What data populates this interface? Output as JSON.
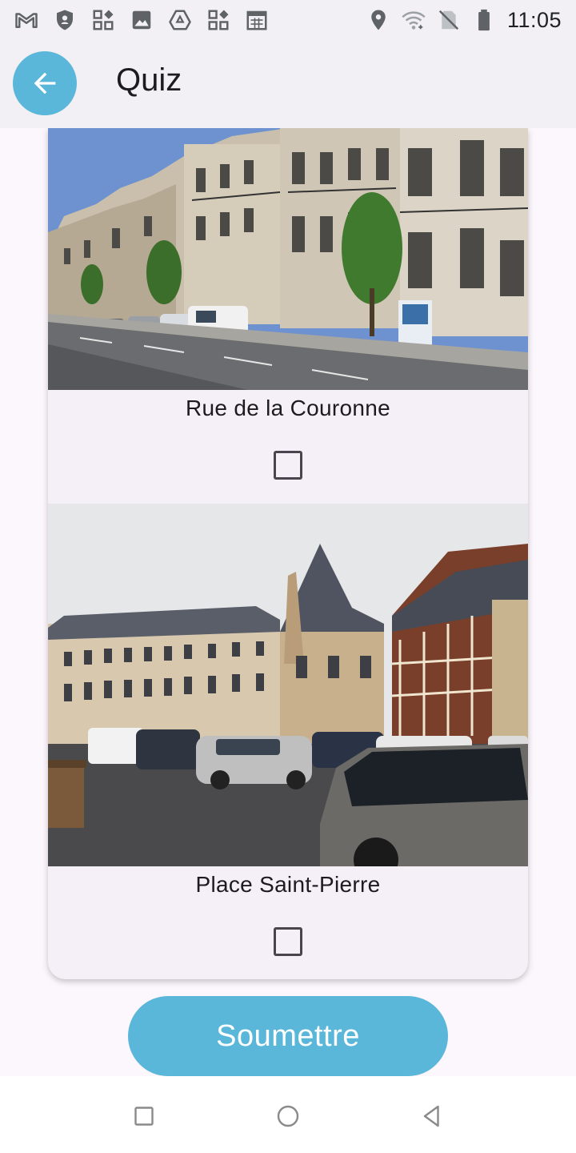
{
  "status_bar": {
    "time": "11:05",
    "left_icons": [
      "gmail-icon",
      "shield-icon",
      "widgets-icon",
      "image-icon",
      "drive-icon",
      "widgets-icon",
      "calendar-icon"
    ],
    "right_icons": [
      "location-icon",
      "wifi-icon",
      "no-sim-icon",
      "battery-icon"
    ]
  },
  "app_bar": {
    "title": "Quiz",
    "accent_color": "#5bb7d9"
  },
  "options": [
    {
      "label": "Rue de la Couronne",
      "checked": false
    },
    {
      "label": "Place Saint-Pierre",
      "checked": false
    }
  ],
  "submit": {
    "label": "Soumettre"
  },
  "nav_bar": {
    "icons": [
      "recents-icon",
      "home-icon",
      "back-icon"
    ]
  }
}
